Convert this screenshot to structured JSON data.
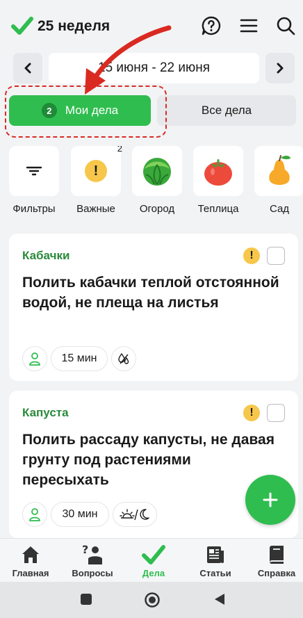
{
  "header": {
    "week_title": "25 неделя"
  },
  "date_range": {
    "value": "15 июня - 22 июня"
  },
  "tabs": {
    "my_label": "Мои дела",
    "my_count": "2",
    "all_label": "Все дела"
  },
  "categories": [
    {
      "label": "Фильтры",
      "icon": "filter-icon",
      "badge": ""
    },
    {
      "label": "Важные",
      "icon": "warning-icon",
      "badge": "2"
    },
    {
      "label": "Огород",
      "icon": "cabbage-icon",
      "badge": ""
    },
    {
      "label": "Теплица",
      "icon": "tomato-icon",
      "badge": ""
    },
    {
      "label": "Сад",
      "icon": "pear-icon",
      "badge": ""
    }
  ],
  "tasks": [
    {
      "category": "Кабачки",
      "title": "Полить кабачки теплой отстоянной водой, не плеща на листья",
      "duration": "15 мин",
      "extra_icon": "drops-icon"
    },
    {
      "category": "Капуста",
      "title": "Полить рассаду капусты, не давая грунту под растениями пересыхать",
      "duration": "30 мин",
      "extra_icon": "sunrise-moon-icon"
    }
  ],
  "nav": [
    {
      "label": "Главная",
      "icon": "home-icon"
    },
    {
      "label": "Вопросы",
      "icon": "questions-icon"
    },
    {
      "label": "Дела",
      "icon": "check-icon",
      "active": true
    },
    {
      "label": "Статьи",
      "icon": "articles-icon"
    },
    {
      "label": "Справка",
      "icon": "book-icon"
    }
  ],
  "colors": {
    "accent": "#2fbd4f",
    "annotation": "#d92a22",
    "warning": "#f6c74a",
    "category_text": "#2a8a3a"
  }
}
